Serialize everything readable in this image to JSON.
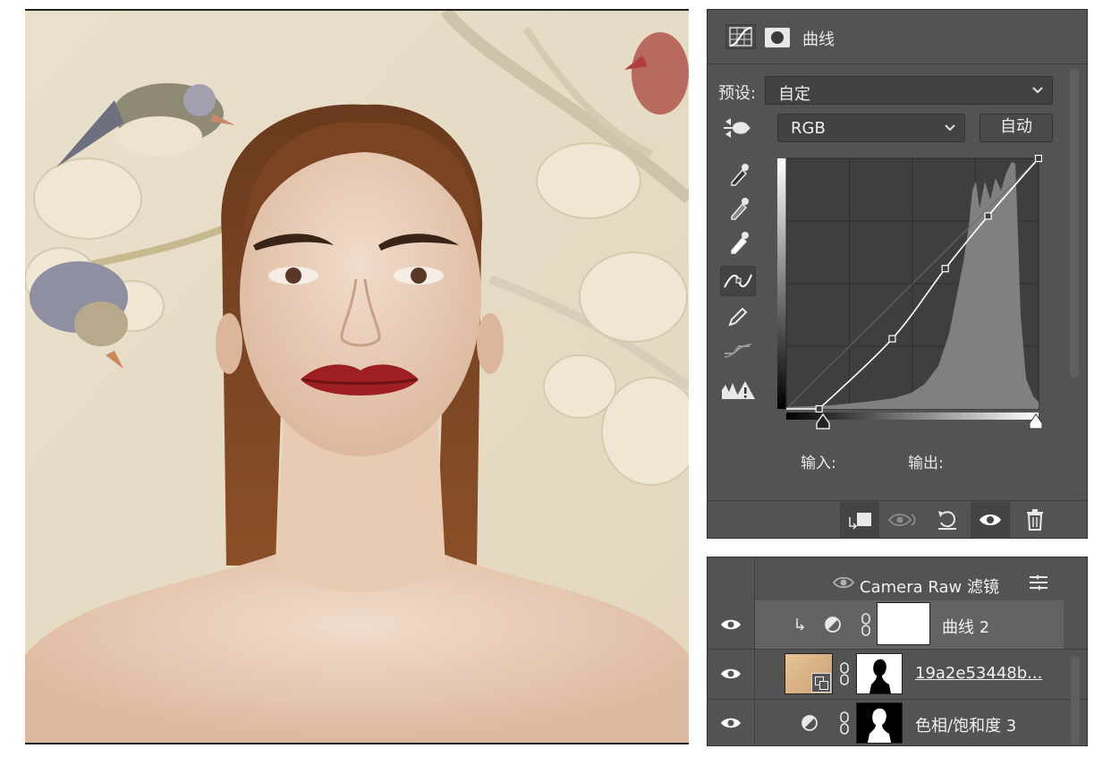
{
  "properties_panel": {
    "title": "曲线",
    "tab_icons": [
      "curves-adjustment-icon",
      "mask-icon"
    ],
    "preset_label": "预设:",
    "preset_value": "自定",
    "channel_value": "RGB",
    "auto_button": "自动",
    "input_label": "输入:",
    "output_label": "输出:",
    "tools": [
      "targeted-adjustment-icon",
      "black-point-eyedropper-icon",
      "gray-point-eyedropper-icon",
      "white-point-eyedropper-icon",
      "curve-points-icon",
      "pencil-icon",
      "smooth-curve-icon",
      "clipping-warning-icon"
    ],
    "footer_buttons": [
      "clip-to-layer-icon",
      "view-previous-state-icon",
      "reset-icon",
      "visibility-icon",
      "delete-icon"
    ],
    "curve_points": [
      [
        0.13,
        0.0
      ],
      [
        0.42,
        0.28
      ],
      [
        0.63,
        0.56
      ],
      [
        0.8,
        0.77
      ],
      [
        1.0,
        1.0
      ]
    ]
  },
  "layers_panel": {
    "rows": [
      {
        "name": "Camera Raw 滤镜",
        "type": "smart-filter"
      },
      {
        "name": "曲线 2",
        "type": "adjustment",
        "selected": true,
        "clipped": true
      },
      {
        "name": "19a2e53448b...",
        "type": "smart-object"
      },
      {
        "name": "色相/饱和度 3",
        "type": "adjustment"
      }
    ],
    "accent": "#636363"
  }
}
